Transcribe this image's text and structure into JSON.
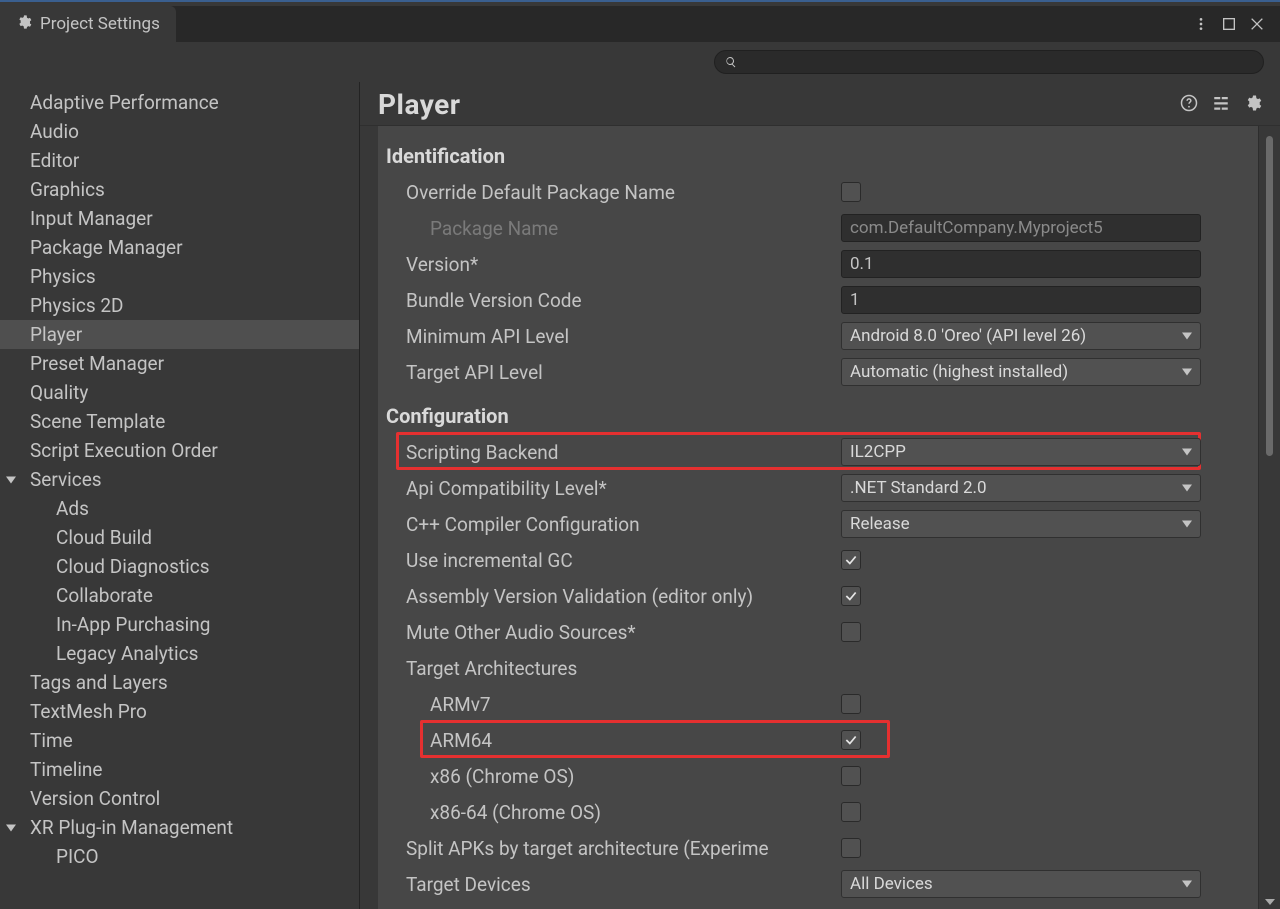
{
  "tab": {
    "title": "Project Settings"
  },
  "sidebar": {
    "items": [
      {
        "label": "Adaptive Performance",
        "kind": "top"
      },
      {
        "label": "Audio",
        "kind": "top"
      },
      {
        "label": "Editor",
        "kind": "top"
      },
      {
        "label": "Graphics",
        "kind": "top"
      },
      {
        "label": "Input Manager",
        "kind": "top"
      },
      {
        "label": "Package Manager",
        "kind": "top"
      },
      {
        "label": "Physics",
        "kind": "top"
      },
      {
        "label": "Physics 2D",
        "kind": "top"
      },
      {
        "label": "Player",
        "kind": "top",
        "selected": true
      },
      {
        "label": "Preset Manager",
        "kind": "top"
      },
      {
        "label": "Quality",
        "kind": "top"
      },
      {
        "label": "Scene Template",
        "kind": "top"
      },
      {
        "label": "Script Execution Order",
        "kind": "top"
      },
      {
        "label": "Services",
        "kind": "top",
        "expander": true
      },
      {
        "label": "Ads",
        "kind": "child"
      },
      {
        "label": "Cloud Build",
        "kind": "child"
      },
      {
        "label": "Cloud Diagnostics",
        "kind": "child"
      },
      {
        "label": "Collaborate",
        "kind": "child"
      },
      {
        "label": "In-App Purchasing",
        "kind": "child"
      },
      {
        "label": "Legacy Analytics",
        "kind": "child"
      },
      {
        "label": "Tags and Layers",
        "kind": "top"
      },
      {
        "label": "TextMesh Pro",
        "kind": "top"
      },
      {
        "label": "Time",
        "kind": "top"
      },
      {
        "label": "Timeline",
        "kind": "top"
      },
      {
        "label": "Version Control",
        "kind": "top"
      },
      {
        "label": "XR Plug-in Management",
        "kind": "top",
        "expander": true
      },
      {
        "label": "PICO",
        "kind": "child"
      }
    ]
  },
  "main": {
    "title": "Player",
    "sections": {
      "identification": {
        "title": "Identification",
        "override_label": "Override Default Package Name",
        "override_checked": false,
        "package_label": "Package Name",
        "package_value": "com.DefaultCompany.Myproject5",
        "version_label": "Version*",
        "version_value": "0.1",
        "bvc_label": "Bundle Version Code",
        "bvc_value": "1",
        "minapi_label": "Minimum API Level",
        "minapi_value": "Android 8.0 'Oreo' (API level 26)",
        "tgtapi_label": "Target API Level",
        "tgtapi_value": "Automatic (highest installed)"
      },
      "configuration": {
        "title": "Configuration",
        "backend_label": "Scripting Backend",
        "backend_value": "IL2CPP",
        "apicompat_label": "Api Compatibility Level*",
        "apicompat_value": ".NET Standard 2.0",
        "cpp_label": "C++ Compiler Configuration",
        "cpp_value": "Release",
        "gc_label": "Use incremental GC",
        "gc_checked": true,
        "avv_label": "Assembly Version Validation (editor only)",
        "avv_checked": true,
        "mute_label": "Mute Other Audio Sources*",
        "mute_checked": false,
        "arch_label": "Target Architectures",
        "arch_armv7_label": "ARMv7",
        "arch_armv7_checked": false,
        "arch_arm64_label": "ARM64",
        "arch_arm64_checked": true,
        "arch_x86_label": "x86 (Chrome OS)",
        "arch_x86_checked": false,
        "arch_x8664_label": "x86-64 (Chrome OS)",
        "arch_x8664_checked": false,
        "split_label": "Split APKs by target architecture (Experime",
        "split_checked": false,
        "tgtdev_label": "Target Devices",
        "tgtdev_value": "All Devices"
      }
    }
  }
}
